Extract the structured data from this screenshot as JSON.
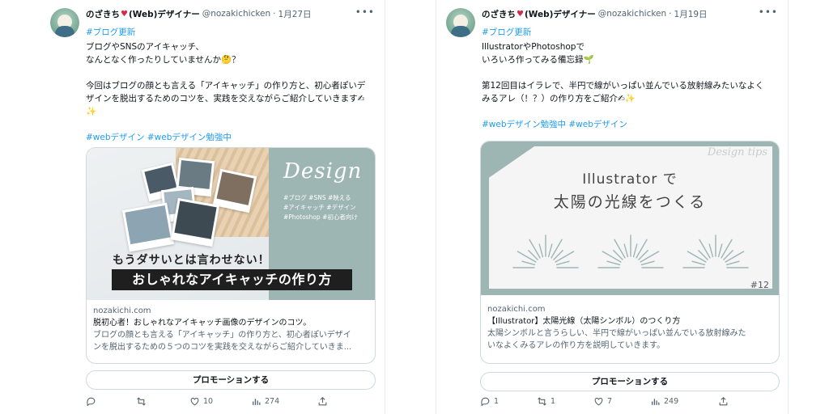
{
  "tweets": [
    {
      "author_name": "のざきち",
      "author_suffix": "(Web)デザイナー",
      "handle": "@nozakichicken",
      "separator": "·",
      "date": "1月27日",
      "top_hashtag": "#ブログ更新",
      "body_lines": [
        "ブログやSNSのアイキャッチ、",
        "なんとなく作ったりしていませんか🤔？",
        "",
        "今回はブログの顔とも言える「アイキャッチ」の作り方と、初心者ぽいデ",
        "ザインを脱出するためのコツを、実践を交えながらご紹介していきます✍",
        "✨",
        "",
        "#webデザイン #webデザイン勉強中"
      ],
      "card": {
        "image": {
          "script_word": "Design",
          "chips": [
            "#ブログ #SNS #映える",
            "#アイキャッチ #デザイン",
            "#Photoshop #初心者向け"
          ],
          "subtitle": "もうダサいとは言わせない！",
          "banner": "おしゃれなアイキャッチの作り方"
        },
        "domain": "nozakichi.com",
        "title": "脱初心者！おしゃれなアイキャッチ画像のデザインのコツ。",
        "desc_lines": [
          "ブログの顔とも言える「アイキャッチ」の作り方と、初心者ぽいデザイ",
          "ンを脱出するための５つのコツを実践を交えながらご紹介していきま..."
        ]
      },
      "promote_label": "プロモーションする",
      "actions": {
        "replies": "",
        "retweets": "",
        "likes": "10",
        "views": "274"
      }
    },
    {
      "author_name": "のざきち",
      "author_suffix": "(Web)デザイナー",
      "handle": "@nozakichicken",
      "separator": "·",
      "date": "1月19日",
      "top_hashtag": "#ブログ更新",
      "body_lines": [
        "IllustratorやPhotoshopで",
        "いろいろ作ってみる備忘録🌱",
        "",
        "第12回目はイラレで、半円で線がいっぱい並んでいる放射線みたいなよく",
        "みるアレ（！？）の作り方をご紹介✍✨",
        "",
        "#webデザイン勉強中 #webデザイン"
      ],
      "card": {
        "image": {
          "script_word": "Design tips",
          "title_line1": "Illustrator で",
          "title_line2": "太陽の光線をつくる",
          "number": "#12"
        },
        "domain": "nozakichi.com",
        "title": "【Illustrator】太陽光線（太陽シンボル）のつくり方",
        "desc_lines": [
          "太陽シンボルと言うらしい、半円で線がいっぱい並んでいる放射線みた",
          "いなよくみるアレの作り方を説明していきます。"
        ]
      },
      "promote_label": "プロモーションする",
      "actions": {
        "replies": "1",
        "retweets": "1",
        "likes": "7",
        "views": "249"
      }
    }
  ],
  "colors": {
    "link": "#1d9bf0",
    "muted": "#536471",
    "card_accent": "#9db5b3",
    "heart": "#d62a4a"
  },
  "icons": [
    "more-icon",
    "reply-icon",
    "retweet-icon",
    "like-icon",
    "views-icon",
    "share-icon",
    "heart-emoji-icon"
  ]
}
